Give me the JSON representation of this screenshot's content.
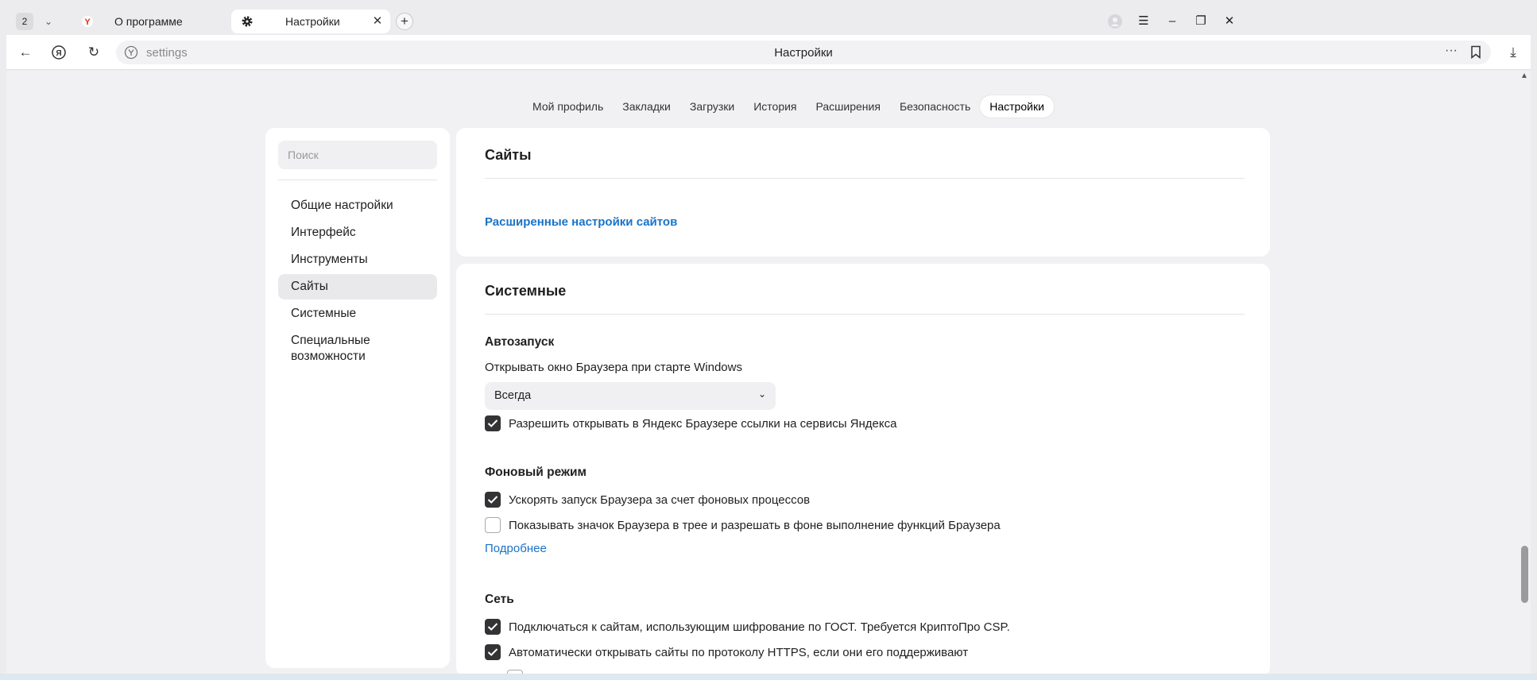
{
  "tabbar": {
    "tab_count": "2",
    "tabs": [
      {
        "label": "О программе",
        "icon": "yandex-y-icon"
      },
      {
        "label": "Настройки",
        "icon": "gear-icon"
      }
    ]
  },
  "addressbar": {
    "url": "settings",
    "page_title": "Настройки"
  },
  "topnav": {
    "items": [
      "Мой профиль",
      "Закладки",
      "Загрузки",
      "История",
      "Расширения",
      "Безопасность",
      "Настройки"
    ],
    "active": "Настройки"
  },
  "sidebar": {
    "search_placeholder": "Поиск",
    "items": [
      "Общие настройки",
      "Интерфейс",
      "Инструменты",
      "Сайты",
      "Системные",
      "Специальные возможности"
    ],
    "active": "Сайты"
  },
  "sites_card": {
    "title": "Сайты",
    "advanced_link": "Расширенные настройки сайтов"
  },
  "system_card": {
    "title": "Системные",
    "autostart": {
      "title": "Автозапуск",
      "label": "Открывать окно Браузера при старте Windows",
      "select_value": "Всегда",
      "checkbox": {
        "label": "Разрешить открывать в Яндекс Браузере ссылки на сервисы Яндекса",
        "checked": true
      }
    },
    "background": {
      "title": "Фоновый режим",
      "checkboxes": [
        {
          "label": "Ускорять запуск Браузера за счет фоновых процессов",
          "checked": true
        },
        {
          "label": "Показывать значок Браузера в трее и разрешать в фоне выполнение функций Браузера",
          "checked": false
        }
      ],
      "more_link": "Подробнее"
    },
    "network": {
      "title": "Сеть",
      "checkboxes": [
        {
          "label": "Подключаться к сайтам, использующим шифрование по ГОСТ. Требуется КриптоПро CSP.",
          "checked": true
        },
        {
          "label": "Автоматически открывать сайты по протоколу HTTPS, если они его поддерживают",
          "checked": true
        }
      ]
    }
  },
  "colors": {
    "accent_link": "#1a73c8",
    "checkbox_checked": "#333336"
  }
}
